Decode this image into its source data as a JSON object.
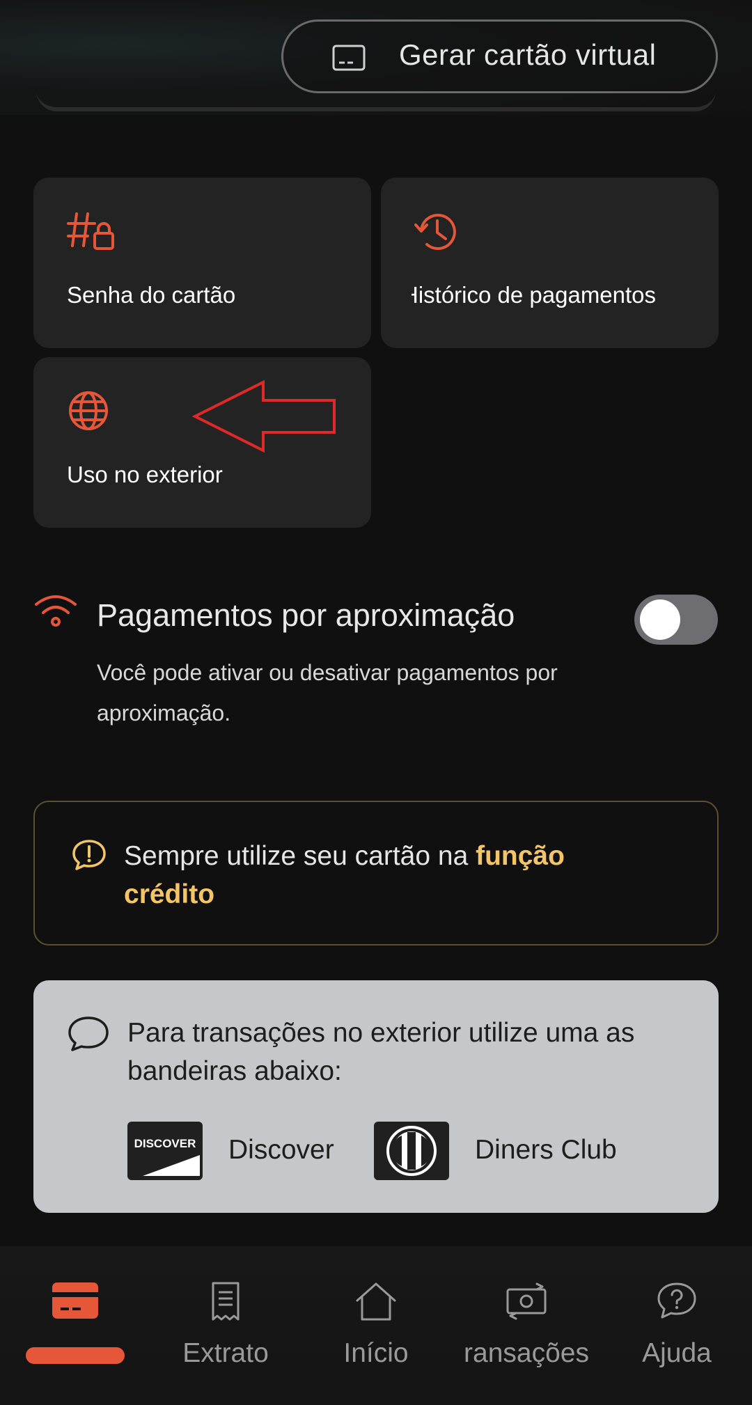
{
  "header": {
    "virtual_card_label": "Gerar cartão virtual"
  },
  "options": {
    "password_label": "Senha do cartão",
    "history_label": "Histórico de pagamentos",
    "abroad_label": "Uso no exterior"
  },
  "contactless": {
    "title": "Pagamentos por aproximação",
    "description": "Você pode ativar ou desativar pagamentos por aproximação.",
    "enabled": false
  },
  "credit_notice": {
    "text_prefix": "Sempre utilize seu cartão na ",
    "highlight": "função crédito"
  },
  "brands_info": {
    "text": "Para transações no exterior utilize uma as bandeiras abaixo:",
    "discover_logo_text": "DISCOVER",
    "discover_label": "Discover",
    "diners_label": "Diners Club"
  },
  "bottom_nav": {
    "extrato": "Extrato",
    "inicio": "Início",
    "transacoes": "ransações",
    "ajuda": "Ajuda"
  },
  "colors": {
    "accent": "#e6573a",
    "highlight": "#f4c566",
    "background": "#101010",
    "tile": "#232323"
  }
}
